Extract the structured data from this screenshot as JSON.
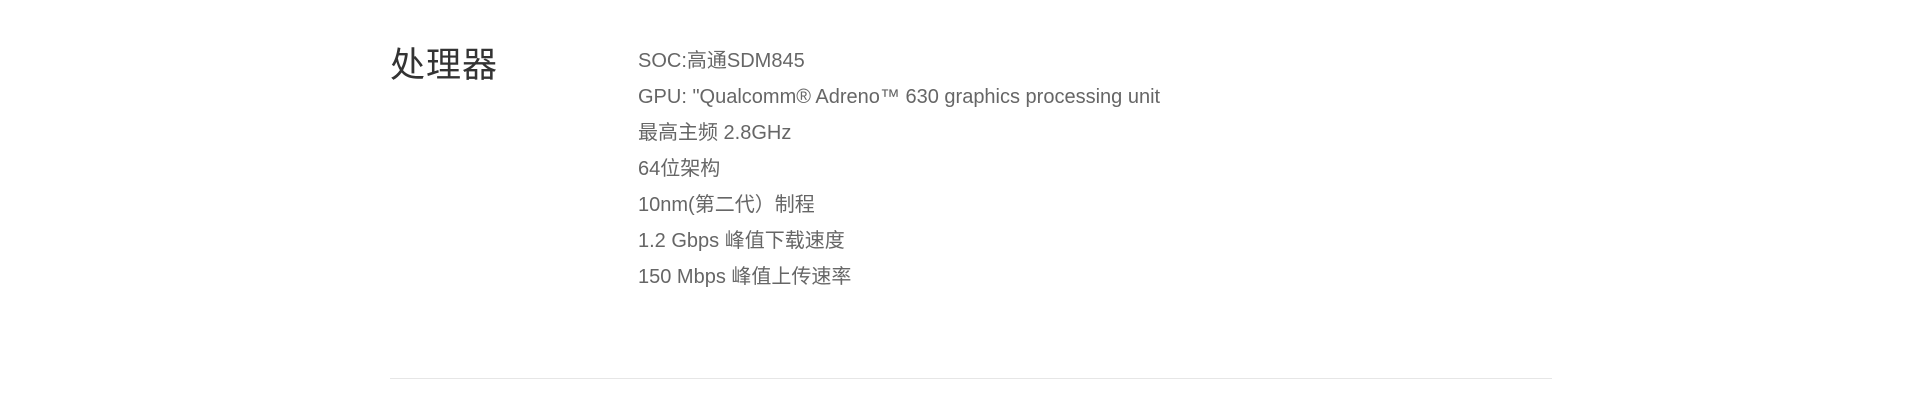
{
  "section": {
    "title": "处理器",
    "specs": [
      "SOC:高通SDM845",
      "GPU: \"Qualcomm® Adreno™ 630 graphics processing unit",
      "最高主频 2.8GHz",
      "64位架构",
      "10nm(第二代）制程",
      "1.2 Gbps 峰值下载速度",
      "150 Mbps 峰值上传速率"
    ]
  }
}
